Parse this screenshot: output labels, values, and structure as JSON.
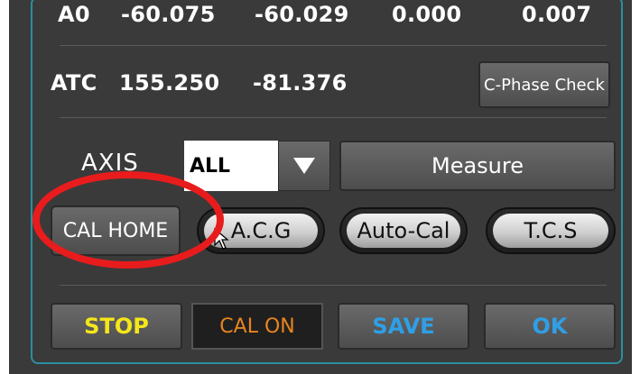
{
  "readings": {
    "a0": {
      "label": "A0",
      "v1": "-60.075",
      "v2": "-60.029",
      "v3": "0.000",
      "v4": "0.007"
    },
    "atc": {
      "label": "ATC",
      "v1": "155.250",
      "v2": "-81.376"
    }
  },
  "buttons": {
    "c_phase_check": "C-Phase Check",
    "measure": "Measure",
    "cal_home": "CAL HOME",
    "acg": "A.C.G",
    "auto_cal": "Auto-Cal",
    "tcs": "T.C.S",
    "stop": "STOP",
    "cal_on": "CAL ON",
    "save": "SAVE",
    "ok": "OK"
  },
  "axis": {
    "label": "AXIS",
    "selected": "ALL"
  },
  "colors": {
    "stop_text": "#f5e61a",
    "cal_on_text": "#e8851e",
    "save_text": "#2f9fe6",
    "ok_text": "#2f9fe6",
    "annotation_circle": "#e81c1c",
    "frame_border": "#2a8fa0"
  },
  "icons": {
    "dropdown": "triangle-down-icon",
    "cursor": "mouse-pointer-icon"
  }
}
